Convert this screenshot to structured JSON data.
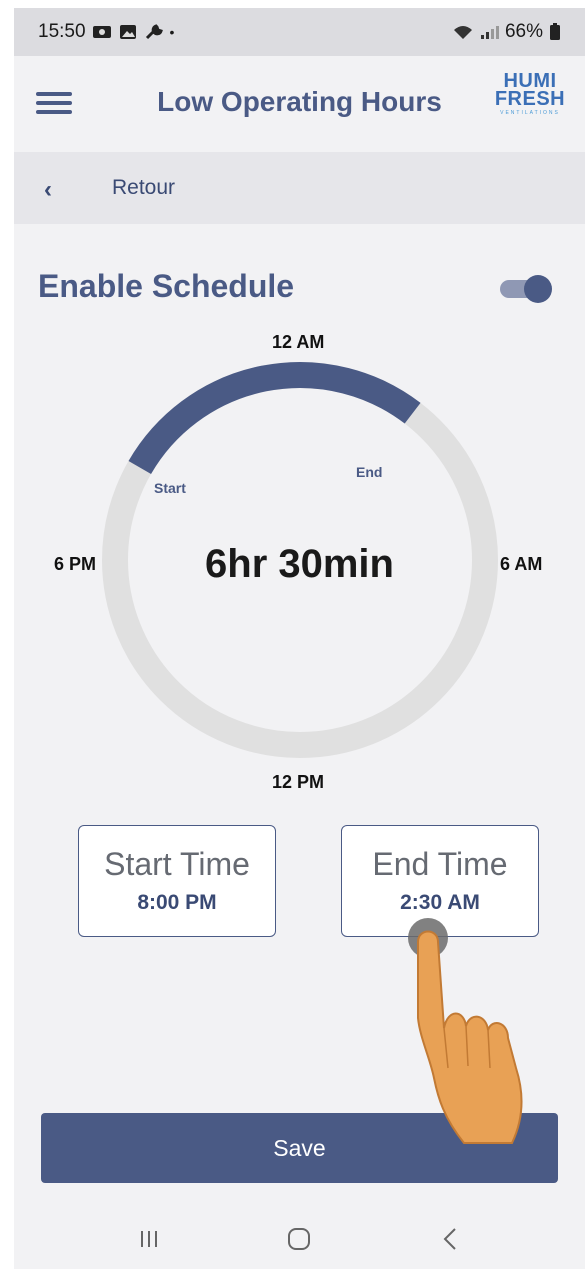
{
  "status_bar": {
    "time": "15:50",
    "battery": "66%",
    "icons": [
      "screen-record-icon",
      "gallery-icon",
      "wrench-icon",
      "dot-icon",
      "wifi-icon",
      "signal-icon",
      "battery-icon"
    ]
  },
  "header": {
    "title": "Low Operating Hours",
    "logo_line1": "HUMI",
    "logo_line2": "FRESH",
    "logo_line3": "VENTILATIONS",
    "accent_color": "#4a5a85"
  },
  "back": {
    "label": "Retour"
  },
  "schedule": {
    "title": "Enable Schedule",
    "enabled": true
  },
  "dial": {
    "label_top": "12 AM",
    "label_right": "6 AM",
    "label_bottom": "12 PM",
    "label_left": "6 PM",
    "start_label": "Start",
    "end_label": "End",
    "duration": "6hr 30min",
    "start_hour": 20.0,
    "end_hour": 26.5,
    "arc_color": "#4a5a85",
    "ring_color": "#e0e0e0"
  },
  "start_time": {
    "label": "Start Time",
    "value": "8:00 PM"
  },
  "end_time": {
    "label": "End Time",
    "value": "2:30 AM"
  },
  "save": {
    "label": "Save"
  },
  "nav": {
    "icons": [
      "recent-apps-icon",
      "home-icon",
      "back-icon"
    ]
  }
}
